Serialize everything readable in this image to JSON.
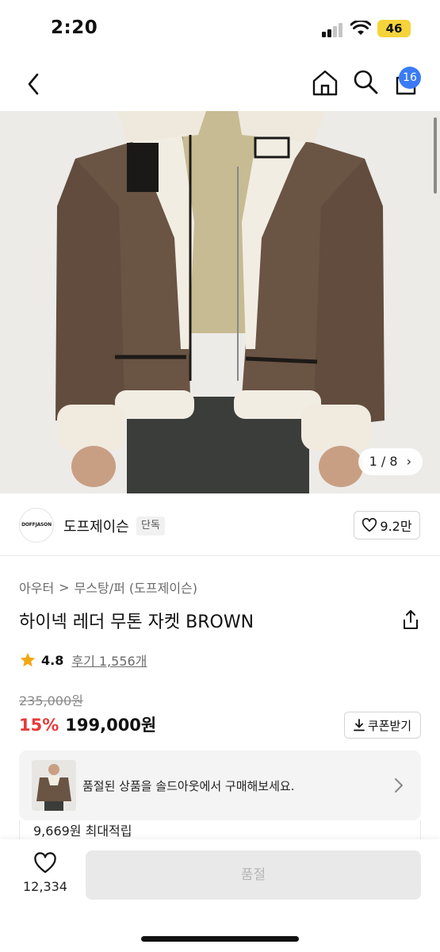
{
  "status_bar": {
    "time": "2:20",
    "battery": "46"
  },
  "nav": {
    "cart_count": "16",
    "icons": [
      "back-chevron-icon",
      "home-icon",
      "search-icon",
      "cart-icon"
    ]
  },
  "hero": {
    "counter": "1 / 8",
    "counter_arrow": "›",
    "alt_description_shown": false
  },
  "brand": {
    "logo_text": "DOFFJASON",
    "name": "도프제이슨",
    "badge": "단독",
    "likes": "9.2만"
  },
  "breadcrumb": {
    "level1": "아우터",
    "separator": ">",
    "level2": "무스탕/퍼 (도프제이슨)"
  },
  "product": {
    "title": "하이넥 레더 무톤 자켓 BROWN",
    "rating": "4.8",
    "reviews": "후기 1,556개",
    "original_price": "235,000원",
    "discount": "15%",
    "sale_price": "199,000원",
    "coupon_label": "쿠폰받기"
  },
  "sold_banner": {
    "text": "품절된 상품을 솔드아웃에서 구매해보세요."
  },
  "points": {
    "text": "9,669원 최대적립"
  },
  "bottom": {
    "wish_count": "12,334",
    "buy_label": "품절"
  },
  "colors": {
    "accent": "#3a7bf5",
    "discount": "#e83a3a",
    "star": "#f3a712",
    "battery": "#f5d33b"
  }
}
